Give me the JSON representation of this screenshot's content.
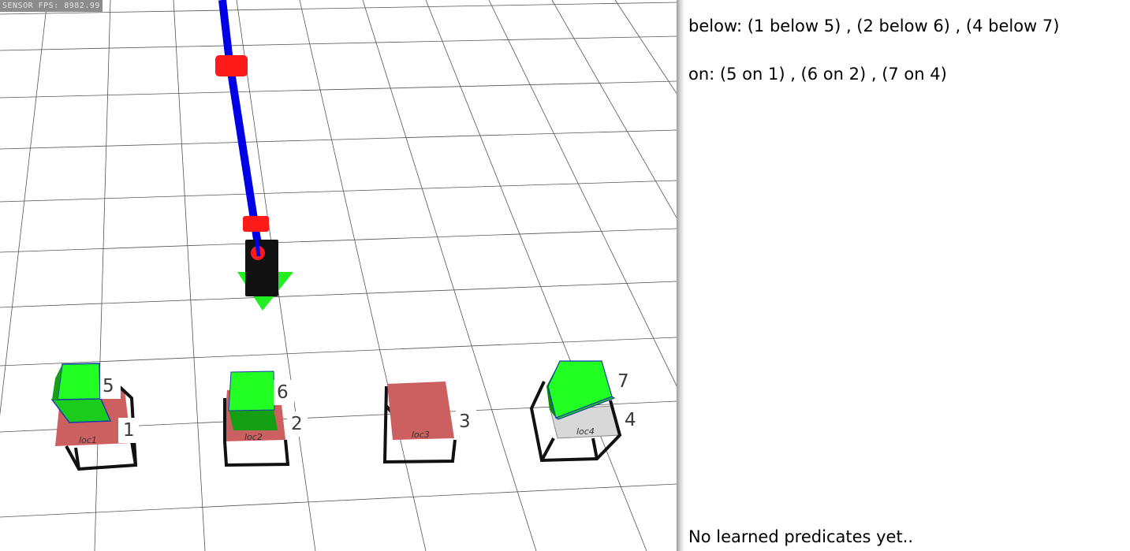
{
  "viewport": {
    "fps_text": "SENSOR FPS: 8982.99",
    "blocks": [
      {
        "id": "1",
        "role": "location base",
        "loc_label": "loc1",
        "color": "#cc5f5f"
      },
      {
        "id": "2",
        "role": "location base",
        "loc_label": "loc2",
        "color": "#cc5f5f"
      },
      {
        "id": "3",
        "role": "location base",
        "loc_label": "loc3",
        "color": "#cc5f5f"
      },
      {
        "id": "4",
        "role": "location base",
        "loc_label": "loc4",
        "color": "#d8d8d8"
      },
      {
        "id": "5",
        "role": "cube",
        "color": "#22ff22"
      },
      {
        "id": "6",
        "role": "cube",
        "color": "#22ff22"
      },
      {
        "id": "7",
        "role": "cube",
        "color": "#22ff22"
      }
    ],
    "colors": {
      "arm_link": "#0000e6",
      "arm_joint": "#ff1a1a",
      "gripper": "#111111",
      "gripper_marker": "#22ee22",
      "grid_line": "#555555"
    }
  },
  "panel": {
    "below_text": "below: (1 below 5) , (2 below 6) , (4 below 7)",
    "on_text": "on: (5 on 1) , (6 on 2) , (7 on 4)",
    "learned_text": "No learned predicates yet.."
  }
}
